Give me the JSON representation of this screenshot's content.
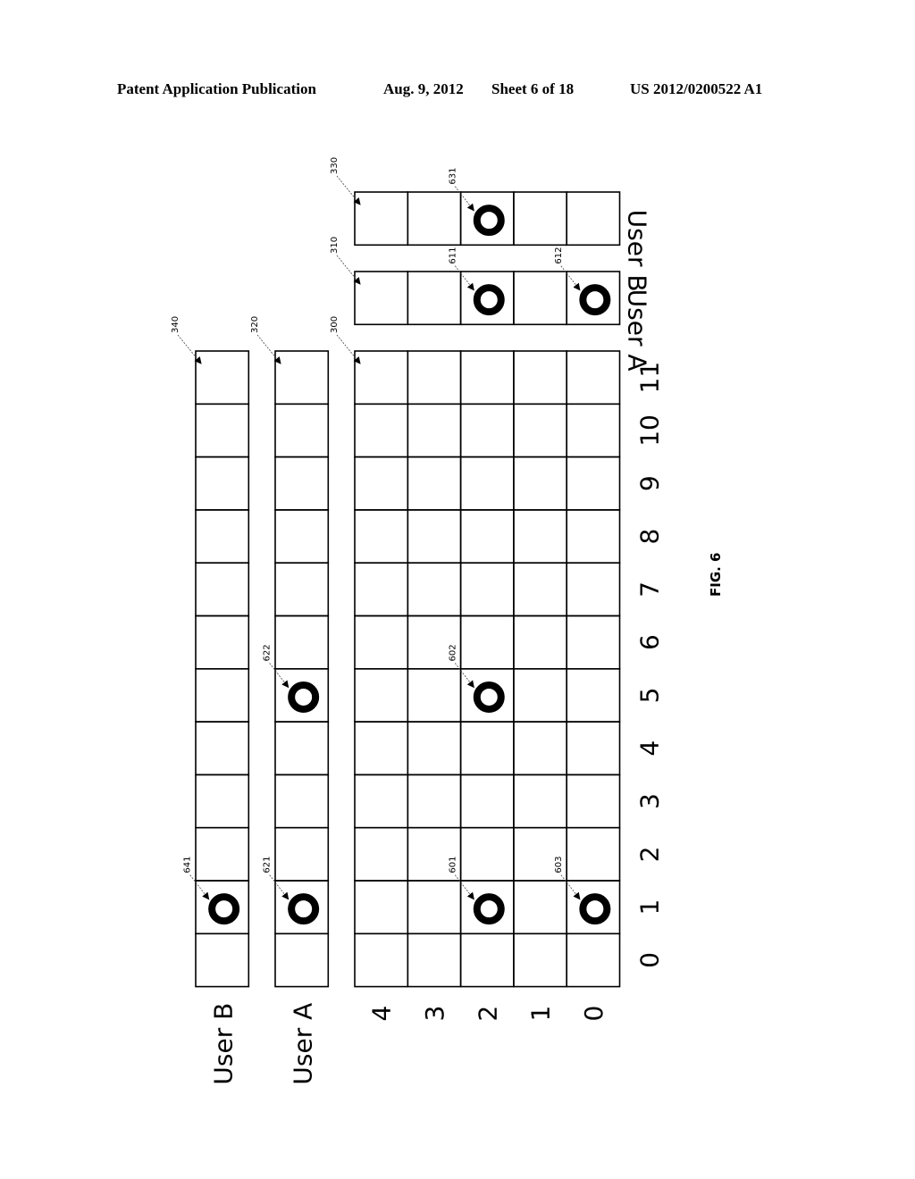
{
  "header": {
    "publication": "Patent Application Publication",
    "date": "Aug. 9, 2012",
    "sheet": "Sheet 6 of 18",
    "number": "US 2012/0200522 A1"
  },
  "figure": {
    "caption": "FIG. 6",
    "grid": {
      "ref": "300",
      "row_labels": [
        "4",
        "3",
        "2",
        "1",
        "0"
      ],
      "column_labels": [
        "0",
        "1",
        "2",
        "3",
        "4",
        "5",
        "6",
        "7",
        "8",
        "9",
        "10",
        "11"
      ],
      "markers": [
        {
          "ref": "601",
          "row": "2",
          "column": "1"
        },
        {
          "ref": "602",
          "row": "2",
          "column": "5"
        },
        {
          "ref": "603",
          "row": "0",
          "column": "1"
        }
      ]
    },
    "column_strips": [
      {
        "ref": "320",
        "label": "User A",
        "markers": [
          {
            "ref": "621",
            "column": "1"
          },
          {
            "ref": "622",
            "column": "5"
          }
        ]
      },
      {
        "ref": "340",
        "label": "User B",
        "markers": [
          {
            "ref": "641",
            "column": "1"
          }
        ]
      }
    ],
    "row_strips": [
      {
        "ref": "310",
        "label": "User A",
        "markers": [
          {
            "ref": "611",
            "row": "2"
          },
          {
            "ref": "612",
            "row": "0"
          }
        ]
      },
      {
        "ref": "330",
        "label": "User B",
        "markers": [
          {
            "ref": "631",
            "row": "2"
          }
        ]
      }
    ]
  }
}
